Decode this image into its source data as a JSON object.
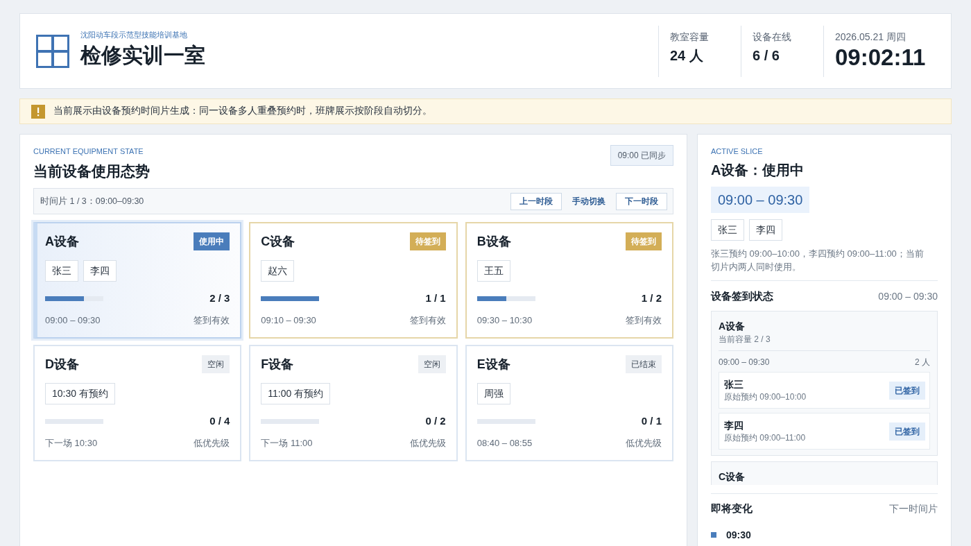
{
  "header": {
    "org": "沈阳动车段示范型技能培训基地",
    "title": "检修实训一室",
    "stats": [
      {
        "label": "教室容量",
        "value": "24 人"
      },
      {
        "label": "设备在线",
        "value": "6 / 6"
      }
    ],
    "datetime": {
      "date": "2026.05.21 周四",
      "time": "09:02:11"
    }
  },
  "notice": {
    "text": "当前展示由设备预约时间片生成：同一设备多人重叠预约时，班牌展示按阶段自动切分。"
  },
  "equipment_state": {
    "eyebrow": "CURRENT EQUIPMENT STATE",
    "title": "当前设备使用态势",
    "sync_badge": "09:00 已同步",
    "slice_label": "时间片 1 / 3：09:00–09:30",
    "controls": [
      {
        "label": "上一时段",
        "kind": "outlined"
      },
      {
        "label": "手动切换",
        "kind": "plain"
      },
      {
        "label": "下一时段",
        "kind": "outlined"
      }
    ],
    "cards": [
      {
        "name": "A设备",
        "status": {
          "kind": "using",
          "label": "使用中"
        },
        "selected": true,
        "chips": [
          "张三",
          "李四"
        ],
        "level": 0.667,
        "count": "2 / 3",
        "time": "09:00 – 09:30",
        "note": "签到有效"
      },
      {
        "name": "C设备",
        "status": {
          "kind": "pending",
          "label": "待签到"
        },
        "selected": false,
        "chips": [
          "赵六"
        ],
        "level": 1,
        "count": "1 / 1",
        "time": "09:10 – 09:30",
        "note": "签到有效"
      },
      {
        "name": "B设备",
        "status": {
          "kind": "pending",
          "label": "待签到"
        },
        "selected": false,
        "chips": [
          "王五"
        ],
        "level": 0.5,
        "count": "1 / 2",
        "time": "09:30 – 10:30",
        "note": "签到有效"
      },
      {
        "name": "D设备",
        "status": {
          "kind": "idle",
          "label": "空闲"
        },
        "selected": false,
        "chips": [
          "10:30 有预约"
        ],
        "count": "0 / 4",
        "time": "下一场 10:30",
        "note": "低优先级"
      },
      {
        "name": "F设备",
        "status": {
          "kind": "idle",
          "label": "空闲"
        },
        "selected": false,
        "chips": [
          "11:00 有预约"
        ],
        "count": "0 / 2",
        "time": "下一场 11:00",
        "note": "低优先级"
      },
      {
        "name": "E设备",
        "status": {
          "kind": "ended",
          "label": "已结束"
        },
        "selected": false,
        "chips": [
          "周强"
        ],
        "count": "0 / 1",
        "time": "08:40 – 08:55",
        "note": "低优先级"
      }
    ]
  },
  "active_slice": {
    "eyebrow": "ACTIVE SLICE",
    "title": "A设备：使用中",
    "time_range": "09:00 – 09:30",
    "people": [
      "张三",
      "李四"
    ],
    "description": "张三预约 09:00–10:00，李四预约 09:00–11:00；当前切片内两人同时使用。",
    "checkin": {
      "title": "设备签到状态",
      "range": "09:00 – 09:30",
      "groups": [
        {
          "name": "A设备",
          "capacity": "当前容量 2 / 3",
          "slots": [
            {
              "range": "09:00 – 09:30",
              "count": "2 人",
              "people": [
                {
                  "name": "张三",
                  "booking": "原始预约 09:00–10:00",
                  "status": {
                    "kind": "checked_in",
                    "label": "已签到"
                  }
                },
                {
                  "name": "李四",
                  "booking": "原始预约 09:00–11:00",
                  "status": {
                    "kind": "checked_in",
                    "label": "已签到"
                  }
                }
              ]
            }
          ]
        },
        {
          "name": "C设备"
        }
      ]
    },
    "upcoming": {
      "title": "即将变化",
      "hint": "下一时间片",
      "items": [
        {
          "time": "09:30"
        }
      ]
    }
  }
}
